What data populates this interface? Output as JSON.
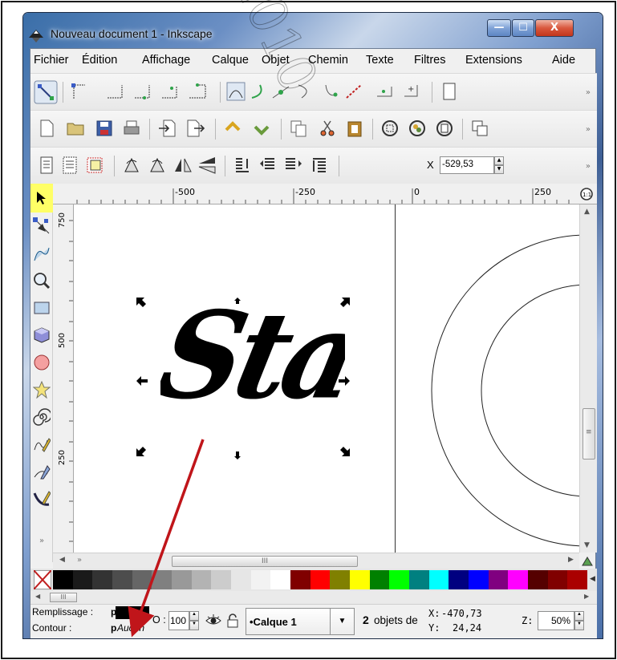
{
  "watermark": "2010",
  "window": {
    "title": "Nouveau document 1 - Inkscape",
    "controls": {
      "minimize": "—",
      "maximize": "☐",
      "close": "X"
    }
  },
  "menu": [
    "Fichier",
    "Édition",
    "Affichage",
    "Calque",
    "Objet",
    "Chemin",
    "Texte",
    "Filtres",
    "Extensions",
    "Aide"
  ],
  "toolbar3": {
    "x_label": "X",
    "x_value": "-529,53"
  },
  "rulers": {
    "top_ticks": [
      "-500",
      "-250",
      "0",
      "250"
    ],
    "left_ticks": [
      "750",
      "500",
      "250"
    ]
  },
  "canvas": {
    "artwork_text": "Star"
  },
  "hscroll": {
    "thumb": "III"
  },
  "palette_scroll": {
    "thumb": "III"
  },
  "palette_colors": [
    "#000000",
    "#1a1a1a",
    "#333333",
    "#4d4d4d",
    "#666666",
    "#808080",
    "#999999",
    "#b3b3b3",
    "#cccccc",
    "#e6e6e6",
    "#f2f2f2",
    "#ffffff",
    "#800000",
    "#ff0000",
    "#808000",
    "#ffff00",
    "#008000",
    "#00ff00",
    "#008080",
    "#00ffff",
    "#000080",
    "#0000ff",
    "#800080",
    "#ff00ff",
    "#550000",
    "#800000",
    "#aa0000"
  ],
  "status": {
    "fill_label": "Remplissage :",
    "fill_p": "p",
    "stroke_label": "Contour :",
    "stroke_p": "p",
    "stroke_value": "Aucun",
    "opacity_label": "O :",
    "opacity_value": "100",
    "layer_value": "•Calque 1",
    "selection_count": "2",
    "selection_text": "objets de",
    "cursor_x_label": "X:",
    "cursor_x": "-470,73",
    "cursor_y_label": "Y:",
    "cursor_y": "24,24",
    "zoom_label": "Z:",
    "zoom_value": "50%"
  },
  "colors": {
    "annotation_arrow": "#c0151a",
    "active_tool": "#ffff66",
    "title_gradient": "#6b8fc4"
  }
}
